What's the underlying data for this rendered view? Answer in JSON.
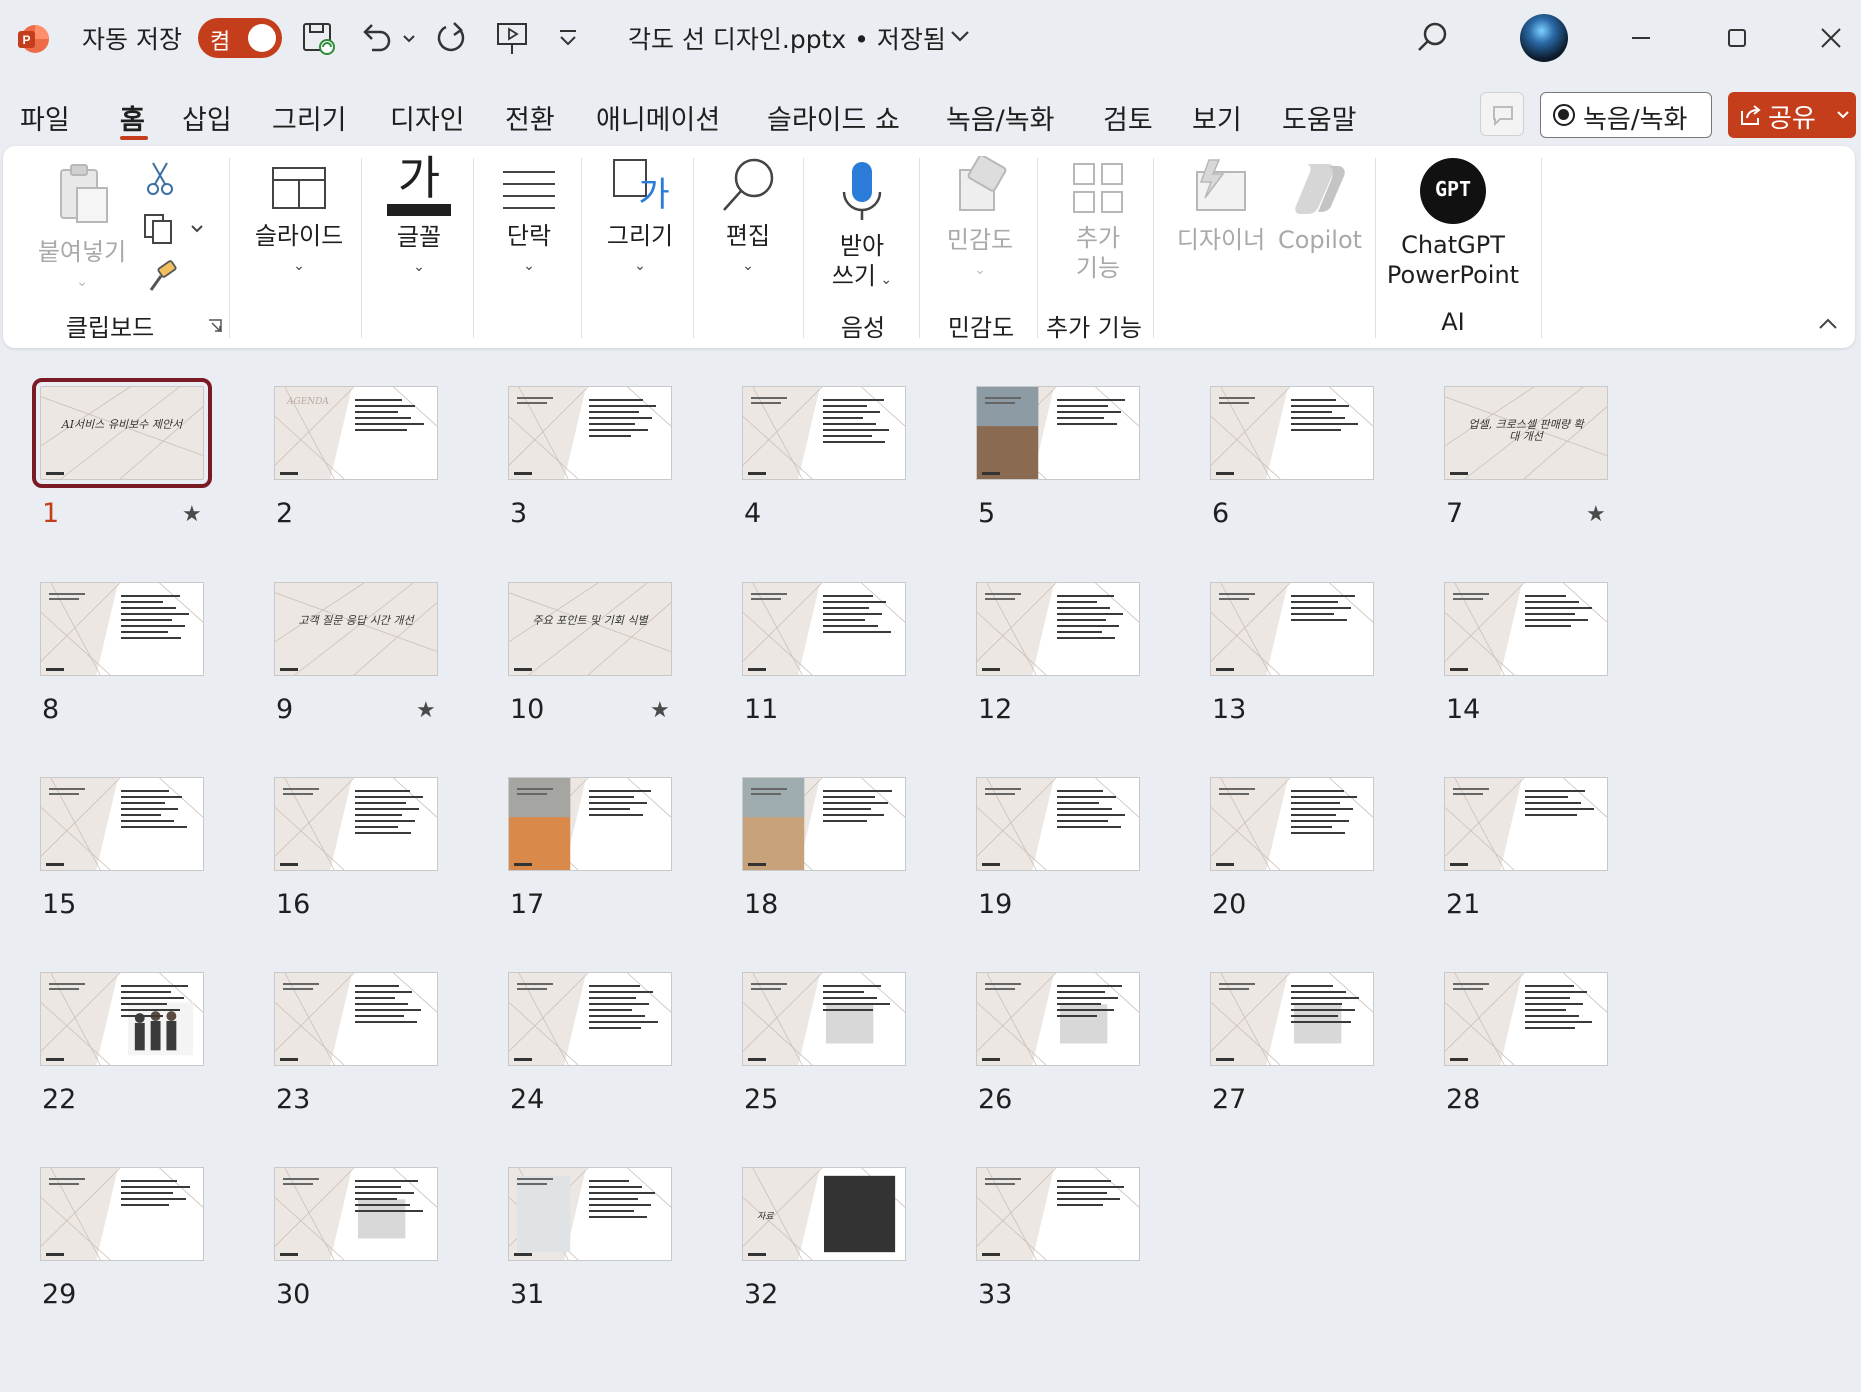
{
  "titlebar": {
    "autosave_label": "자동 저장",
    "toggle_state": "켬",
    "document_title": "각도 선 디자인.pptx • 저장됨"
  },
  "tabs": [
    {
      "label": "파일"
    },
    {
      "label": "홈"
    },
    {
      "label": "삽입"
    },
    {
      "label": "그리기"
    },
    {
      "label": "디자인"
    },
    {
      "label": "전환"
    },
    {
      "label": "애니메이션"
    },
    {
      "label": "슬라이드 쇼"
    },
    {
      "label": "녹음/녹화"
    },
    {
      "label": "검토"
    },
    {
      "label": "보기"
    },
    {
      "label": "도움말"
    }
  ],
  "toolbar": {
    "record_label": "녹음/녹화",
    "share_label": "공유"
  },
  "ribbon": {
    "paste": "붙여넣기",
    "clipboard": "클립보드",
    "slide": "슬라이드",
    "font_glyph": "가",
    "font": "글꼴",
    "paragraph": "단락",
    "draw": "그리기",
    "edit": "편집",
    "dictate_1": "받아",
    "dictate_2": "쓰기",
    "voice": "음성",
    "sensitivity": "민감도",
    "sensitivity_group": "민감도",
    "addins_1": "추가",
    "addins_2": "기능",
    "addins_group": "추가 기능",
    "designer": "디자이너",
    "copilot": "Copilot",
    "gpt_logo": "GPT",
    "chatgpt_1": "ChatGPT",
    "chatgpt_2": "PowerPoint",
    "ai_group": "AI"
  },
  "slides": [
    {
      "num": "1",
      "star": true
    },
    {
      "num": "2",
      "star": false
    },
    {
      "num": "3",
      "star": false
    },
    {
      "num": "4",
      "star": false
    },
    {
      "num": "5",
      "star": false
    },
    {
      "num": "6",
      "star": false
    },
    {
      "num": "7",
      "star": true
    },
    {
      "num": "8",
      "star": false
    },
    {
      "num": "9",
      "star": true
    },
    {
      "num": "10",
      "star": true
    },
    {
      "num": "11",
      "star": false
    },
    {
      "num": "12",
      "star": false
    },
    {
      "num": "13",
      "star": false
    },
    {
      "num": "14",
      "star": false
    },
    {
      "num": "15",
      "star": false
    },
    {
      "num": "16",
      "star": false
    },
    {
      "num": "17",
      "star": false
    },
    {
      "num": "18",
      "star": false
    },
    {
      "num": "19",
      "star": false
    },
    {
      "num": "20",
      "star": false
    },
    {
      "num": "21",
      "star": false
    },
    {
      "num": "22",
      "star": false
    },
    {
      "num": "23",
      "star": false
    },
    {
      "num": "24",
      "star": false
    },
    {
      "num": "25",
      "star": false
    },
    {
      "num": "26",
      "star": false
    },
    {
      "num": "27",
      "star": false
    },
    {
      "num": "28",
      "star": false
    },
    {
      "num": "29",
      "star": false
    },
    {
      "num": "30",
      "star": false
    },
    {
      "num": "31",
      "star": false
    },
    {
      "num": "32",
      "star": false
    },
    {
      "num": "33",
      "star": false
    }
  ],
  "slide_titles": {
    "s1": "AI서비스 유비보수 제안서",
    "s2": "AGENDA",
    "s7": "업셀, 크로스셀 판매량 확대 개선",
    "s9": "고객 질문 응답 시간 개선",
    "s10": "주요 포인트 및 기회 식별",
    "s32": "자료"
  },
  "colors": {
    "accent": "#c43e1c",
    "selected_outline": "#7a1a24",
    "background": "#eaeef2"
  }
}
